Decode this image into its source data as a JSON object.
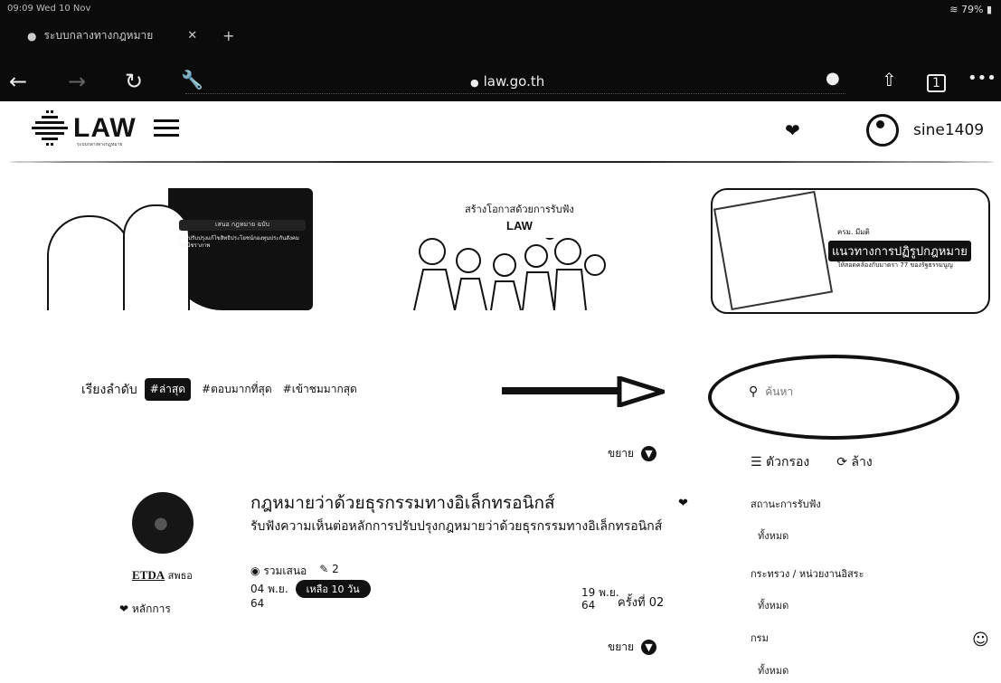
{
  "browser": {
    "status_left": "09:09 Wed 10 Nov",
    "status_right": "79%",
    "tab_title": "ระบบกลางทางกฎหมาย",
    "url": "law.go.th"
  },
  "site": {
    "logo_text": "LAW",
    "logo_sub": "ระบบกลางทางกฎหมาย",
    "username": "sine1409"
  },
  "banners": {
    "b1_pill": "เสนอ กฎหมาย ฉบับ",
    "b1_lines": "การปรับปรุงแก้ไขสิทธิประโยชน์กองทุนประกันสังคมกรณีชราภาพ",
    "b2_title": "สร้างโอกาสด้วยการรับฟัง",
    "b2_logo": "LAW",
    "b3_top": "ครม. มีมติ",
    "b3_main": "แนวทางการปฏิรูปกฎหมาย",
    "b3_sub": "ให้สอดคล้องกับมาตรา 77 ของรัฐธรรมนูญ"
  },
  "sort": {
    "label": "เรียงลำดับ",
    "active": "#ล่าสุด",
    "option2": "#ตอบมากที่สุด",
    "option3": "#เข้าชมมากสุด"
  },
  "search": {
    "placeholder": "ค้นหา"
  },
  "filters": {
    "filter_label": "ตัวกรอง",
    "clear_label": "ล้าง",
    "status_label": "สถานะการรับฟัง",
    "status_value": "ทั้งหมด",
    "ministry_label": "กระทรวง / หน่วยงานอิสระ",
    "ministry_value": "ทั้งหมด",
    "type_label": "กรม",
    "type_value": "ทั้งหมด"
  },
  "card": {
    "expand_top": "ขยาย",
    "expand_bottom": "ขยาย",
    "org": "ETDA",
    "org_short": "สพธอ",
    "category": "หลักการ",
    "title": "กฎหมายว่าด้วยธุรกรรมทางอิเล็กทรอนิกส์",
    "description": "รับฟังความเห็นต่อหลักการปรับปรุงกฎหมายว่าด้วยธุรกรรมทางอิเล็กทรอนิกส์",
    "participants": "รวมเสนอ",
    "comments": "2",
    "start_date": "04 พ.ย.",
    "remaining": "เหลือ 10 วัน",
    "start_year": "64",
    "end_date": "19 พ.ย.",
    "end_year": "64",
    "round": "ครั้งที่ 02"
  }
}
